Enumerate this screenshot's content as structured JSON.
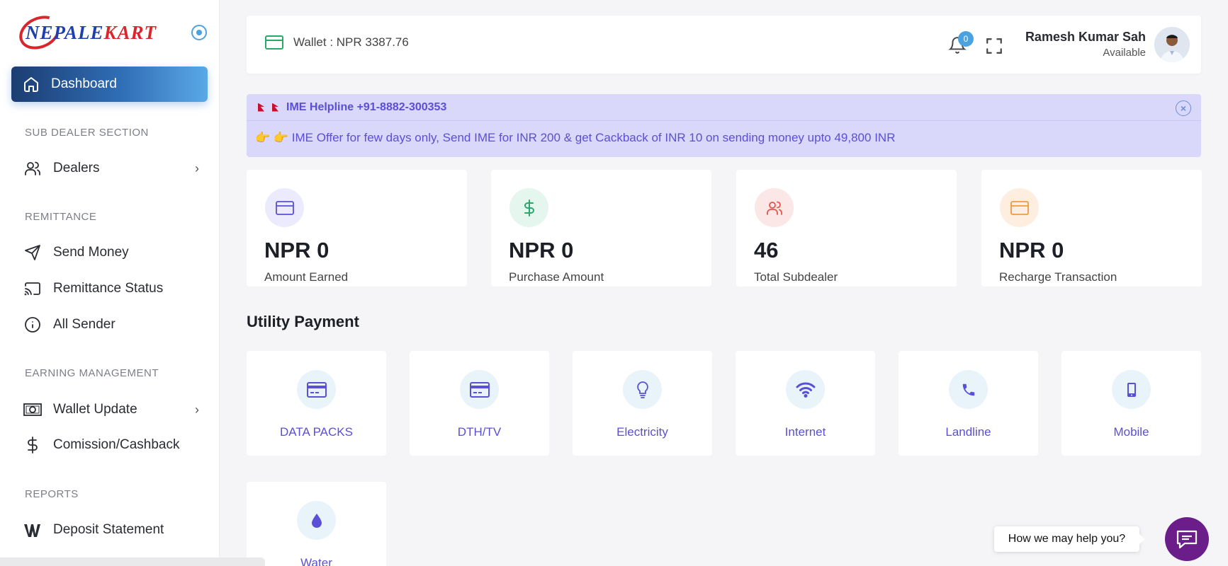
{
  "brand": {
    "logo_text_main": "NEPALE",
    "logo_text_accent": "KART"
  },
  "sidebar": {
    "active": {
      "label": "Dashboard",
      "icon": "home-icon"
    },
    "sections": {
      "sub_dealer": "SUB DEALER SECTION",
      "remittance": "REMITTANCE",
      "earning": "EARNING MANAGEMENT",
      "reports": "REPORTS"
    },
    "items": {
      "dealers": "Dealers",
      "send_money": "Send Money",
      "remittance_status": "Remittance Status",
      "all_sender": "All Sender",
      "wallet_update": "Wallet Update",
      "commission": "Comission/Cashback",
      "deposit_statement": "Deposit Statement"
    }
  },
  "header": {
    "wallet_text": "Wallet : NPR 3387.76",
    "notification_count": "0",
    "user_name": "Ramesh Kumar Sah",
    "user_status": "Available"
  },
  "announcement": {
    "helpline": "IME Helpline +91-8882-300353",
    "message": "👉 👉 IME Offer for few days only, Send IME for INR 200 & get Cackback of INR 10 on sending money upto 49,800 INR",
    "close": "×"
  },
  "stats": [
    {
      "value": "NPR 0",
      "label": "Amount Earned",
      "icon": "card-icon",
      "color": "#5a4fd6",
      "bg": "#ecebfd"
    },
    {
      "value": "NPR 0",
      "label": "Purchase Amount",
      "icon": "dollar-icon",
      "color": "#28a86b",
      "bg": "#e5f6ee"
    },
    {
      "value": "46",
      "label": "Total Subdealer",
      "icon": "users-icon",
      "color": "#e0574f",
      "bg": "#fbe7e6"
    },
    {
      "value": "NPR 0",
      "label": "Recharge Transaction",
      "icon": "card-icon",
      "color": "#f09a3e",
      "bg": "#fdeee0"
    }
  ],
  "utility": {
    "title": "Utility Payment",
    "tiles": [
      {
        "label": "DATA PACKS",
        "icon": "credit-card-icon"
      },
      {
        "label": "DTH/TV",
        "icon": "credit-card-icon"
      },
      {
        "label": "Electricity",
        "icon": "bulb-icon"
      },
      {
        "label": "Internet",
        "icon": "wifi-icon"
      },
      {
        "label": "Landline",
        "icon": "phone-icon"
      },
      {
        "label": "Mobile",
        "icon": "mobile-icon"
      },
      {
        "label": "Water",
        "icon": "water-drop-icon"
      }
    ]
  },
  "chat": {
    "prompt": "How we may help you?"
  }
}
